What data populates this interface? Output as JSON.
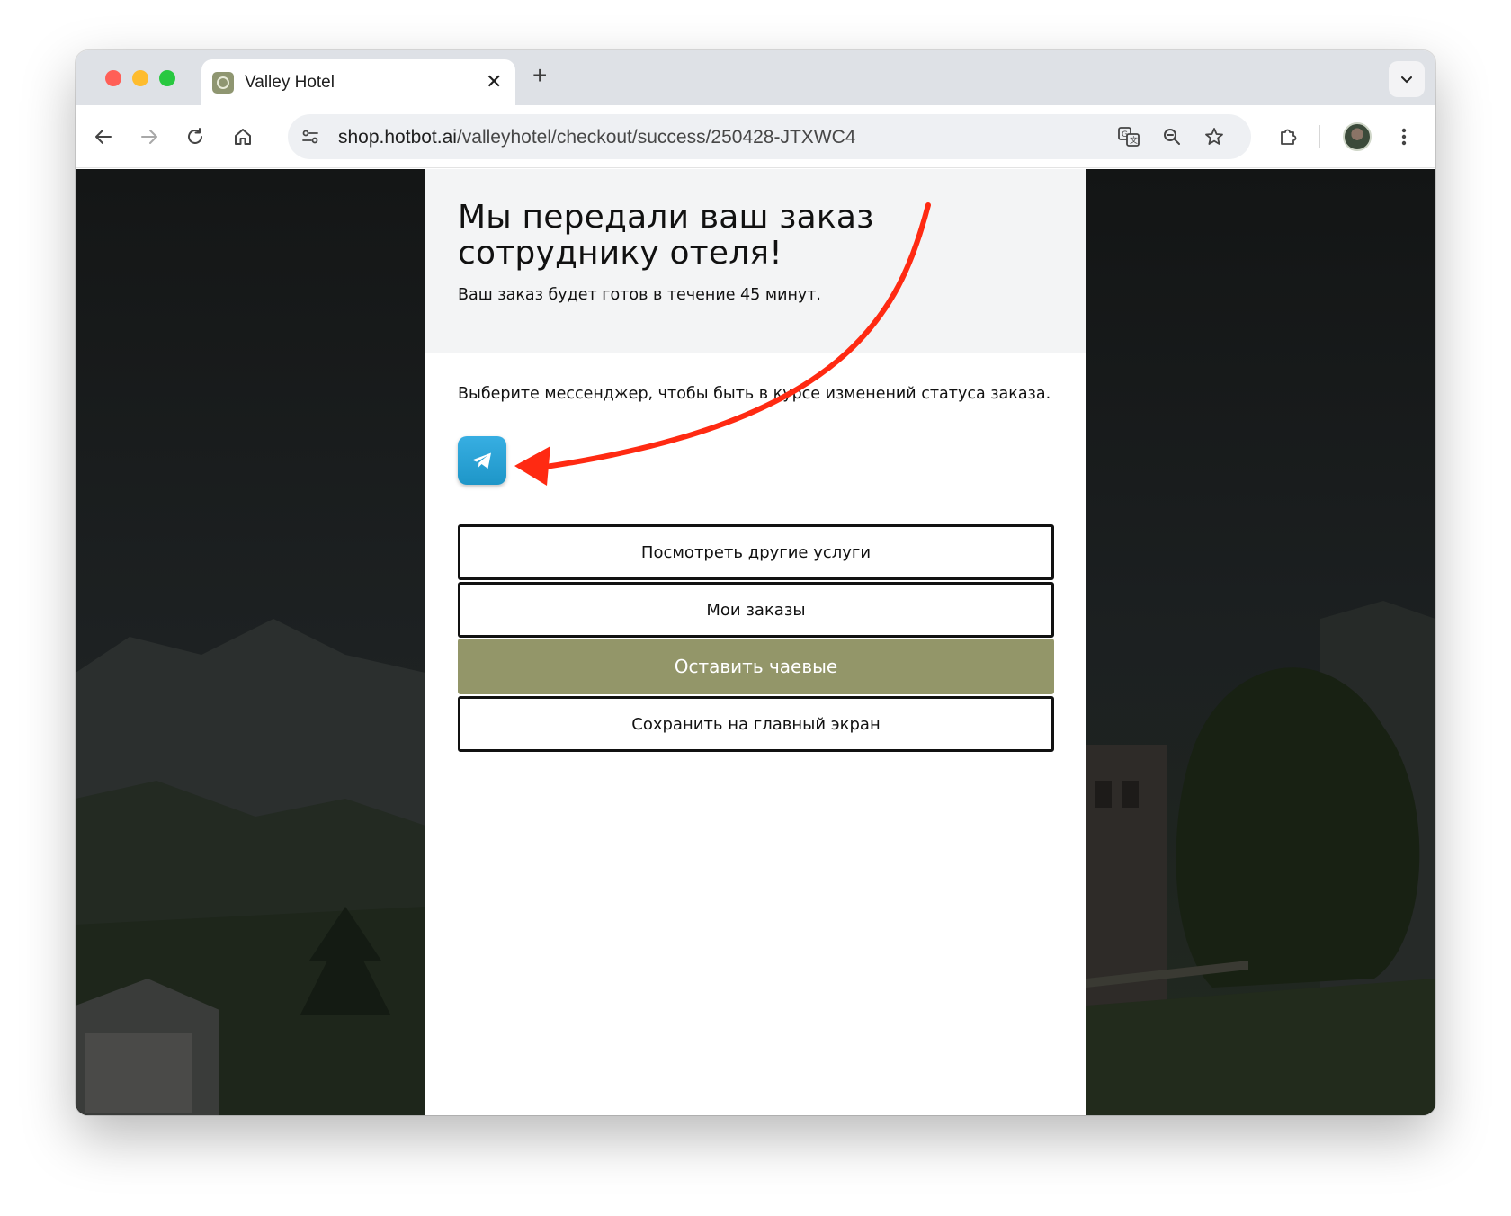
{
  "browser": {
    "tab_title": "Valley Hotel",
    "tab_close": "✕",
    "new_tab": "+",
    "url_host": "shop.hotbot.ai",
    "url_path": "/valleyhotel/checkout/success/250428-JTXWC4"
  },
  "page": {
    "headline": "Мы передали ваш заказ сотруднику отеля!",
    "subline": "Ваш заказ будет готов в течение 45 минут.",
    "messenger_prompt": "Выберите мессенджер, чтобы быть в курсе изменений статуса заказа.",
    "messenger_icon": "telegram-icon",
    "buttons": {
      "other_services": "Посмотреть другие услуги",
      "my_orders": "Мои заказы",
      "leave_tip": "Оставить чаевые",
      "save_home": "Сохранить на главный экран"
    }
  },
  "colors": {
    "tip_button": "#939669",
    "annotation_arrow": "#ff2a12",
    "telegram": "#2aa3d8"
  }
}
